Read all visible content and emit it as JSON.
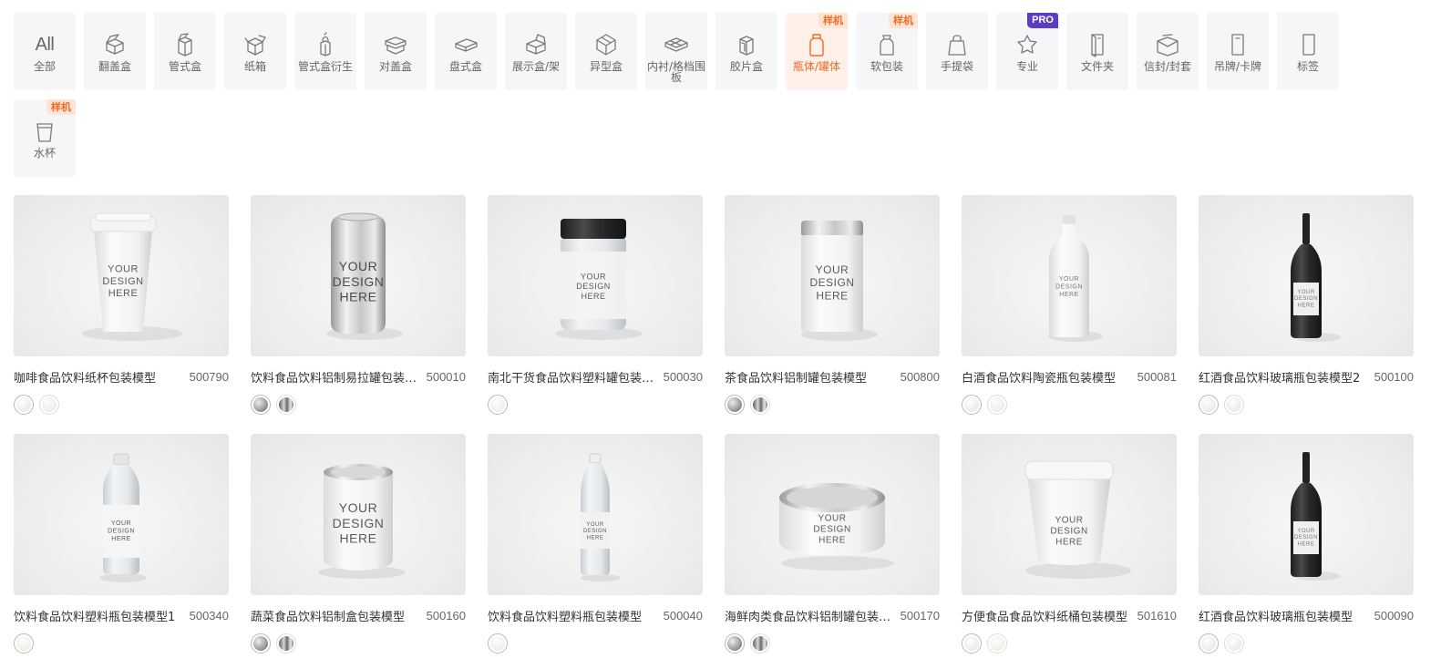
{
  "categories": [
    {
      "label": "全部",
      "icon": "all-text-icon",
      "text": "All"
    },
    {
      "label": "翻盖盒",
      "icon": "flip-box-icon"
    },
    {
      "label": "管式盒",
      "icon": "tube-box-icon"
    },
    {
      "label": "纸箱",
      "icon": "carton-icon"
    },
    {
      "label": "管式盒衍生",
      "icon": "tube-box-derived-icon"
    },
    {
      "label": "对盖盒",
      "icon": "lid-box-icon"
    },
    {
      "label": "盘式盒",
      "icon": "tray-box-icon"
    },
    {
      "label": "展示盒/架",
      "icon": "display-box-icon"
    },
    {
      "label": "异型盒",
      "icon": "special-box-icon"
    },
    {
      "label": "内衬/格档围板",
      "icon": "insert-icon"
    },
    {
      "label": "胶片盒",
      "icon": "film-box-icon"
    },
    {
      "label": "瓶体/罐体",
      "icon": "bottle-icon",
      "badge": "样机",
      "active": true
    },
    {
      "label": "软包装",
      "icon": "pouch-icon",
      "badge": "样机"
    },
    {
      "label": "手提袋",
      "icon": "handbag-icon"
    },
    {
      "label": "专业",
      "icon": "star-box-icon",
      "badge": "PRO",
      "badge_type": "pro"
    },
    {
      "label": "文件夹",
      "icon": "folder-icon"
    },
    {
      "label": "信封/封套",
      "icon": "envelope-icon"
    },
    {
      "label": "吊牌/卡牌",
      "icon": "hang-tag-icon"
    },
    {
      "label": "标签",
      "icon": "label-icon"
    },
    {
      "label": "水杯",
      "icon": "cup-icon",
      "badge": "样机"
    }
  ],
  "products": [
    {
      "name": "咖啡食品饮料纸杯包装模型",
      "id": "500790",
      "model": "paper-cup",
      "swatches": [
        "white",
        "white"
      ],
      "thumb_text": "YOUR DESIGN HERE"
    },
    {
      "name": "饮料食品饮料铝制易拉罐包装模型",
      "id": "500010",
      "model": "soda-can",
      "swatches": [
        "silver",
        "metal"
      ],
      "thumb_text": "YOUR DESIGN HERE"
    },
    {
      "name": "南北干货食品饮料塑料罐包装模型",
      "id": "500030",
      "model": "plastic-jar",
      "swatches": [
        "cream"
      ],
      "thumb_text": "YOUR DESIGN HERE"
    },
    {
      "name": "茶食品饮料铝制罐包装模型",
      "id": "500800",
      "model": "tea-can",
      "swatches": [
        "silver",
        "metal"
      ],
      "thumb_text": "YOUR DESIGN HERE"
    },
    {
      "name": "白酒食品饮料陶瓷瓶包装模型",
      "id": "500081",
      "model": "ceramic-bottle",
      "swatches": [
        "white",
        "white"
      ],
      "thumb_text": "YOUR DESIGN HERE"
    },
    {
      "name": "红酒食品饮料玻璃瓶包装模型2",
      "id": "500100",
      "model": "wine-bottle",
      "swatches": [
        "white",
        "white"
      ],
      "thumb_text": "YOUR DESIGN HERE"
    },
    {
      "name": "饮料食品饮料塑料瓶包装模型1",
      "id": "500340",
      "model": "plastic-bottle",
      "swatches": [
        "cream"
      ],
      "thumb_text": "YOUR DESIGN HERE"
    },
    {
      "name": "蔬菜食品饮料铝制盒包装模型",
      "id": "500160",
      "model": "food-can",
      "swatches": [
        "silver",
        "metal"
      ],
      "thumb_text": "YOUR DESIGN HERE"
    },
    {
      "name": "饮料食品饮料塑料瓶包装模型",
      "id": "500040",
      "model": "water-bottle",
      "swatches": [
        "cream"
      ],
      "thumb_text": "YOUR DESIGN HERE"
    },
    {
      "name": "海鲜肉类食品饮料铝制罐包装模型",
      "id": "500170",
      "model": "tuna-can",
      "swatches": [
        "silver",
        "metal"
      ],
      "thumb_text": "YOUR DESIGN HERE"
    },
    {
      "name": "方便食品食品饮料纸桶包装模型",
      "id": "501610",
      "model": "paper-bucket",
      "swatches": [
        "white",
        "cream"
      ],
      "thumb_text": "YOUR DESIGN HERE"
    },
    {
      "name": "红酒食品饮料玻璃瓶包装模型",
      "id": "500090",
      "model": "wine-bottle-2",
      "swatches": [
        "white",
        "white"
      ],
      "thumb_text": "YOUR DESIGN HERE"
    }
  ]
}
